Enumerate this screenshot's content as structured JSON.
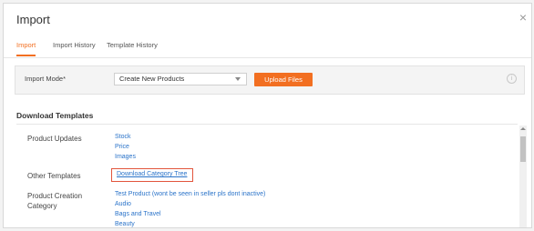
{
  "dialog": {
    "title": "Import",
    "close_glyph": "×"
  },
  "tabs": [
    {
      "label": "Import",
      "active": true
    },
    {
      "label": "Import History",
      "active": false
    },
    {
      "label": "Template History",
      "active": false
    }
  ],
  "import_mode": {
    "label": "Import Mode*",
    "selected": "Create New Products",
    "upload_label": "Upload Files",
    "info_glyph": "i"
  },
  "download_templates": {
    "heading": "Download Templates",
    "product_updates": {
      "label": "Product Updates",
      "links": [
        "Stock",
        "Price",
        "Images"
      ]
    },
    "other_templates": {
      "label": "Other Templates",
      "links": [
        "Download Category Tree"
      ]
    },
    "product_creation": {
      "label": "Product Creation Category",
      "links": [
        "Test Product    (wont be seen in seller pls dont inactive)",
        "Audio",
        "Bags and Travel",
        "Beauty"
      ]
    }
  },
  "colors": {
    "accent": "#f26f21",
    "link": "#2a73c9",
    "highlight": "#e2553c"
  }
}
